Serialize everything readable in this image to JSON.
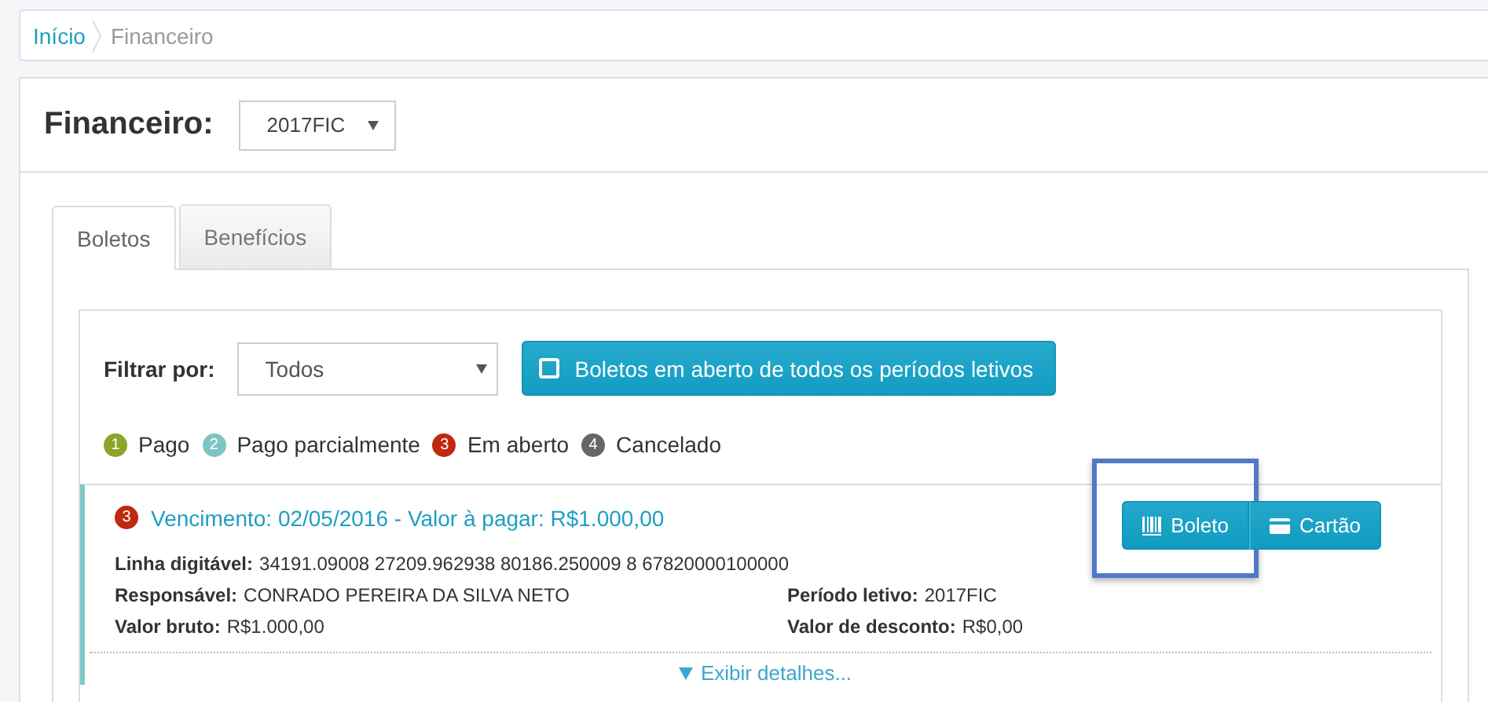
{
  "breadcrumb": [
    {
      "label": "Início",
      "kind": "link"
    },
    {
      "label": "Financeiro",
      "kind": "current"
    }
  ],
  "header": {
    "title": "Financeiro:",
    "period_select": "2017FIC"
  },
  "tabs": [
    {
      "label": "Boletos",
      "selected": true
    },
    {
      "label": "Benefícios",
      "selected": false
    }
  ],
  "filter": {
    "label": "Filtrar por:",
    "value": "Todos",
    "open_button": "Boletos em aberto de todos os períodos letivos",
    "open_checked": false
  },
  "legend": [
    {
      "number": "1",
      "label": "Pago",
      "color": "#8aa52a"
    },
    {
      "number": "2",
      "label": "Pago parcialmente",
      "color": "#7fc4c4"
    },
    {
      "number": "3",
      "label": "Em aberto",
      "color": "#c0280f"
    },
    {
      "number": "4",
      "label": "Cancelado",
      "color": "#666666"
    }
  ],
  "boleto": {
    "status_number": "3",
    "title": "Vencimento: 02/05/2016 - Valor à pagar: R$1.000,00",
    "buttons": [
      {
        "label": "Boleto",
        "kind": "barcode",
        "highlighted": true
      },
      {
        "label": "Cartão",
        "kind": "card",
        "highlighted": false
      }
    ],
    "line": {
      "label": "Linha digitável:",
      "value": "34191.09008 27209.962938 80186.250009 8 67820000100000"
    },
    "fields": [
      {
        "label": "Responsável:",
        "value": "CONRADO PEREIRA DA SILVA NETO"
      },
      {
        "label": "Período letivo:",
        "value": "2017FIC"
      },
      {
        "label": "Valor bruto:",
        "value": "R$1.000,00"
      },
      {
        "label": "Valor de desconto:",
        "value": "R$0,00"
      }
    ],
    "details_link": "Exibir detalhes..."
  }
}
